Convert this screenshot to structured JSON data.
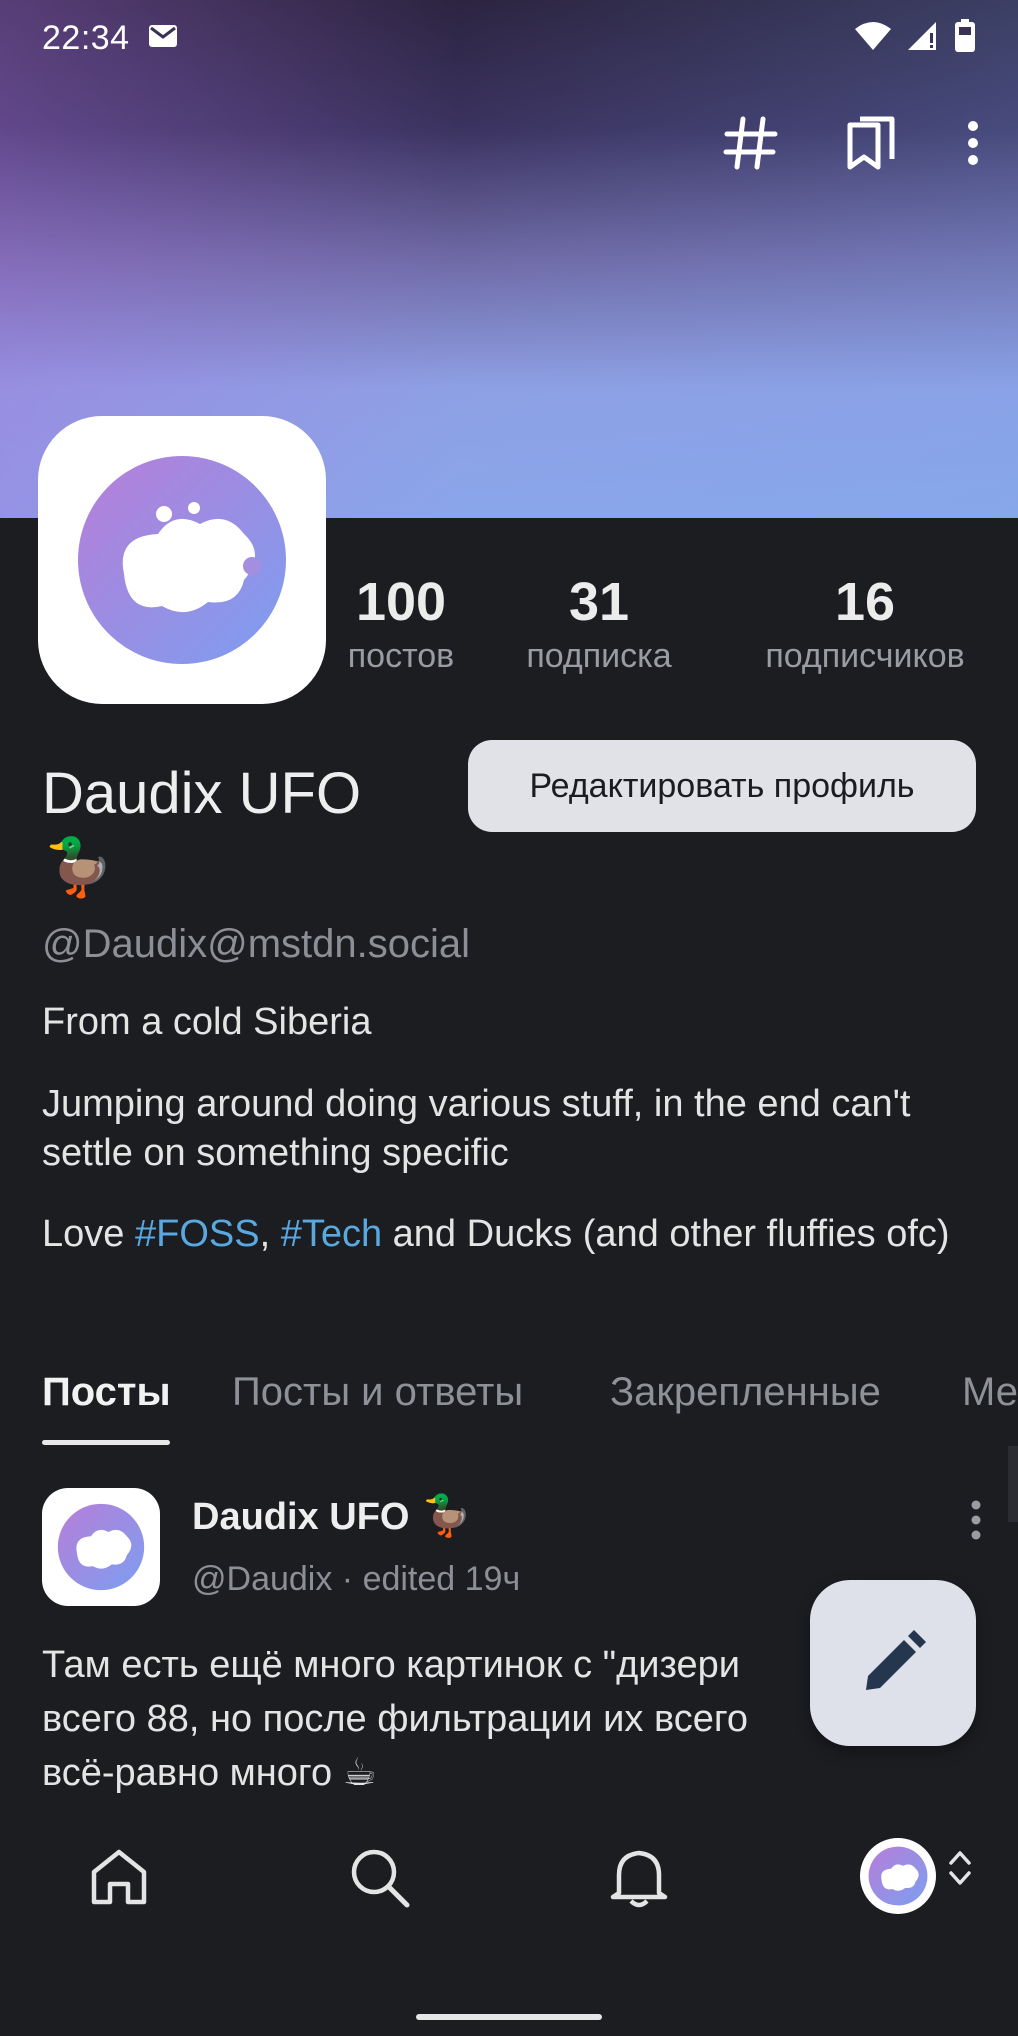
{
  "status_bar": {
    "time": "22:34"
  },
  "profile": {
    "display_name": "Daudix UFO",
    "name_emoji": "🦆",
    "handle": "@Daudix@mstdn.social",
    "edit_button_label": "Редактировать профиль",
    "stats": [
      {
        "value": "100",
        "label": "постов"
      },
      {
        "value": "31",
        "label": "подписка"
      },
      {
        "value": "16",
        "label": "подписчиков"
      }
    ],
    "bio": {
      "line1": "From a cold Siberia",
      "line2": "Jumping around doing various stuff, in the end can't settle on something specific",
      "line3_prefix": "Love ",
      "hashtag1": "#FOSS",
      "separator": ", ",
      "hashtag2": "#Tech",
      "line3_suffix": " and Ducks (and other fluffies ofc)"
    }
  },
  "tabs": [
    {
      "label": "Посты",
      "active": true
    },
    {
      "label": "Посты и ответы",
      "active": false
    },
    {
      "label": "Закрепленные",
      "active": false
    },
    {
      "label": "Ме",
      "active": false
    }
  ],
  "post": {
    "author": "Daudix UFO",
    "author_emoji": "🦆",
    "meta": "@Daudix · edited 19ч",
    "text": "Там есть ещё много картинок с \"дизери\nвсего 88, но после фильтрации их всего\nвсё-равно много ☕"
  },
  "icons": {
    "topbar": [
      "hashtag-icon",
      "bookmarks-icon",
      "more-vert-icon"
    ],
    "bottom_nav": [
      "home-icon",
      "search-icon",
      "bell-icon",
      "account-avatar",
      "chevron-updown-icon"
    ],
    "fab": "pencil-icon"
  },
  "colors": {
    "background": "#1b1d21",
    "hashtag": "#5aa8e0",
    "button_bg": "#e1e2e8"
  }
}
